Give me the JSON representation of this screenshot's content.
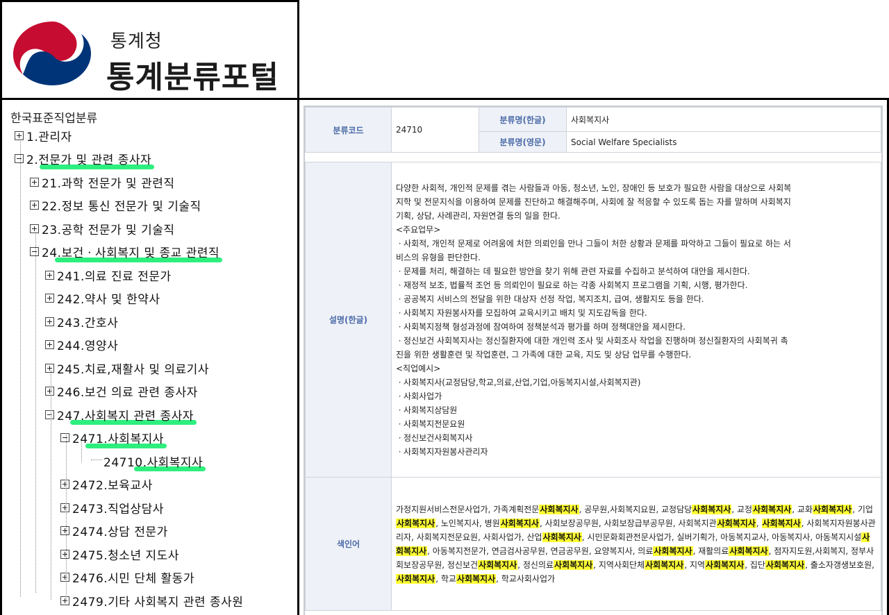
{
  "header": {
    "org_name": "통계청",
    "portal_name": "통계분류포털",
    "colors": {
      "logo_red": "#c60c30",
      "logo_blue": "#003478"
    }
  },
  "tree": {
    "root_label": "한국표준직업분류",
    "items": [
      {
        "label": "1.관리자",
        "state": "collapsed",
        "level": 0
      },
      {
        "label": "2.전문가 및 관련 종사자",
        "state": "expanded",
        "level": 0,
        "highlight": true
      },
      {
        "label": "21.과학 전문가 및 관련직",
        "state": "collapsed",
        "level": 1
      },
      {
        "label": "22.정보 통신 전문가 및 기술직",
        "state": "collapsed",
        "level": 1
      },
      {
        "label": "23.공학 전문가 및 기술직",
        "state": "collapsed",
        "level": 1
      },
      {
        "label": "24.보건ㆍ사회복지 및 종교 관련직",
        "state": "expanded",
        "level": 1,
        "highlight": true
      },
      {
        "label": "241.의료 진료 전문가",
        "state": "collapsed",
        "level": 2
      },
      {
        "label": "242.약사 및 한약사",
        "state": "collapsed",
        "level": 2
      },
      {
        "label": "243.간호사",
        "state": "collapsed",
        "level": 2
      },
      {
        "label": "244.영양사",
        "state": "collapsed",
        "level": 2
      },
      {
        "label": "245.치료,재활사 및 의료기사",
        "state": "collapsed",
        "level": 2
      },
      {
        "label": "246.보건 의료 관련 종사자",
        "state": "collapsed",
        "level": 2
      },
      {
        "label": "247.사회복지 관련 종사자",
        "state": "expanded",
        "level": 2,
        "highlight": true
      },
      {
        "label": "2471.사회복지사",
        "state": "expanded",
        "level": 3,
        "highlight": true
      },
      {
        "label": "24710.사회복지사",
        "state": "leaf",
        "level": 4,
        "highlight": true
      },
      {
        "label": "2472.보육교사",
        "state": "collapsed",
        "level": 3
      },
      {
        "label": "2473.직업상담사",
        "state": "collapsed",
        "level": 3
      },
      {
        "label": "2474.상담 전문가",
        "state": "collapsed",
        "level": 3
      },
      {
        "label": "2475.청소년 지도사",
        "state": "collapsed",
        "level": 3
      },
      {
        "label": "2476.시민 단체 활동가",
        "state": "collapsed",
        "level": 3
      },
      {
        "label": "2479.기타 사회복지 관련 종사원",
        "state": "collapsed",
        "level": 3
      }
    ],
    "highlight_color": "#22ee77"
  },
  "detail": {
    "code_label": "분류코드",
    "code_value": "24710",
    "name_kr_label": "분류명(한글)",
    "name_kr_value": "사회복지사",
    "name_en_label": "분류명(영문)",
    "name_en_value": "Social Welfare Specialists",
    "desc_label": "설명(한글)",
    "desc_lines": [
      "다양한 사회적, 개인적 문제를 겪는 사람들과 아동, 청소년, 노인, 장애인 등 보호가 필요한 사람을 대상으로 사회복",
      "지학 및 전문지식을 이용하여 문제를 진단하고 해결해주며, 사회에 잘 적응할 수 있도록 돕는 자를 말하며 사회복지",
      "기획, 상담, 사례관리, 자원연결 등의 일을 한다.",
      "<주요업무>",
      "ㆍ사회적, 개인적 문제로 어려움에 처한 의뢰인을 만나 그들이 처한 상황과 문제를 파악하고 그들이 필요로 하는 서",
      "비스의 유형을 판단한다.",
      "ㆍ문제를 처리, 해결하는 데 필요한 방안을 찾기 위해 관련 자료를 수집하고 분석하여 대안을 제시한다.",
      "ㆍ재정적 보조, 법률적 조언 등 의뢰인이 필요로 하는 각종 사회복지 프로그램을 기획, 시행, 평가한다.",
      "ㆍ공공복지 서비스의 전달을 위한 대상자 선정 작업, 복지조치, 급여, 생활지도 등을 한다.",
      "ㆍ사회복지 자원봉사자를 모집하여 교육시키고 배치 및 지도감독을 한다.",
      "ㆍ사회복지정책 형성과정에 참여하여 정책분석과 평가를 하며 정책대안을 제시한다.",
      "ㆍ정신보건 사회복지사는 정신질환자에 대한 개인력 조사 및 사회조사 작업을 진행하며 정신질환자의 사회복귀 촉",
      "진을 위한 생활훈련 및 작업훈련, 그 가족에 대한 교육, 지도 및 상담 업무를 수행한다.",
      "<직업예시>",
      "ㆍ사회복지사(교정담당,학교,의료,산업,기업,아동복지시설,사회복지관)",
      "ㆍ사회사업가",
      "ㆍ사회복지상담원",
      "ㆍ사회복지전문요원",
      "ㆍ정신보건사회복지사",
      "ㆍ사회복지자원봉사관리자"
    ],
    "index_label": "색인어",
    "index_segments": [
      "가정지원서비스전문사업가, 가족계획전문",
      "*사회복지사",
      ", 공무원,사회복지요원, 교정담당",
      "*사회복지사",
      ", 교정",
      "*사회복지사",
      ", 교화",
      "*사회복지사",
      ", 기업",
      "*사회복지사",
      ", 노인복지사, 병원",
      "*사회복지사",
      ", 사회보장공무원, 사회보장급부공무원, 사회복지관",
      "*사회복지사",
      ", ",
      "*사회복지사",
      ", 사회복지자원봉사관리자, 사회복지전문요원, 사회사업가, 산업",
      "*사회복지사",
      ", 시민문화회관전문사업가, 실버기획가, 아동복지교사, 아동복지사, 아동복지시설",
      "*사회복지사",
      ", 아동복지전문가, 연금검사공무원, 연금공무원, 요양복지사, 의료",
      "*사회복지사",
      ", 재활의료",
      "*사회복지사",
      ", 점자지도원,사회복지, 정부사회보장공무원, 정신보건",
      "*사회복지사",
      ", 정신의료",
      "*사회복지사",
      ", 지역사회단체",
      "*사회복지사",
      ", 지역",
      "*사회복지사",
      ", 집단",
      "*사회복지사",
      ", 출소자갱생보호원, ",
      "*사회복지사",
      ", 학교",
      "*사회복지사",
      ", 학교사회사업가"
    ],
    "highlight_color": "#ffff33"
  }
}
